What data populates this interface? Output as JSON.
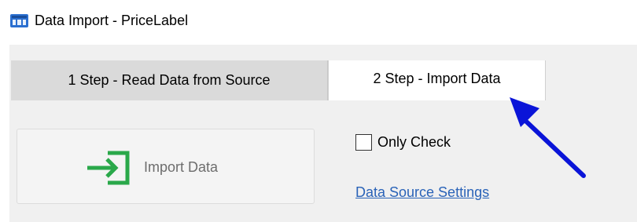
{
  "window": {
    "title": "Data Import - PriceLabel",
    "icon": "data-import-app-icon"
  },
  "tabs": [
    {
      "label": "1 Step - Read Data from Source",
      "selected": false
    },
    {
      "label": "2 Step - Import Data",
      "selected": true
    }
  ],
  "actions": {
    "import_label": "Import Data",
    "import_icon": "import-arrow-icon",
    "import_icon_color": "#2aa84a",
    "import_enabled": false
  },
  "options": {
    "only_check_label": "Only Check",
    "only_check_checked": false
  },
  "links": {
    "data_source_settings": "Data Source Settings",
    "link_color": "#2a63b8"
  },
  "annotation": {
    "arrow_icon": "pointer-arrow-icon",
    "arrow_color": "#0a14d8"
  }
}
